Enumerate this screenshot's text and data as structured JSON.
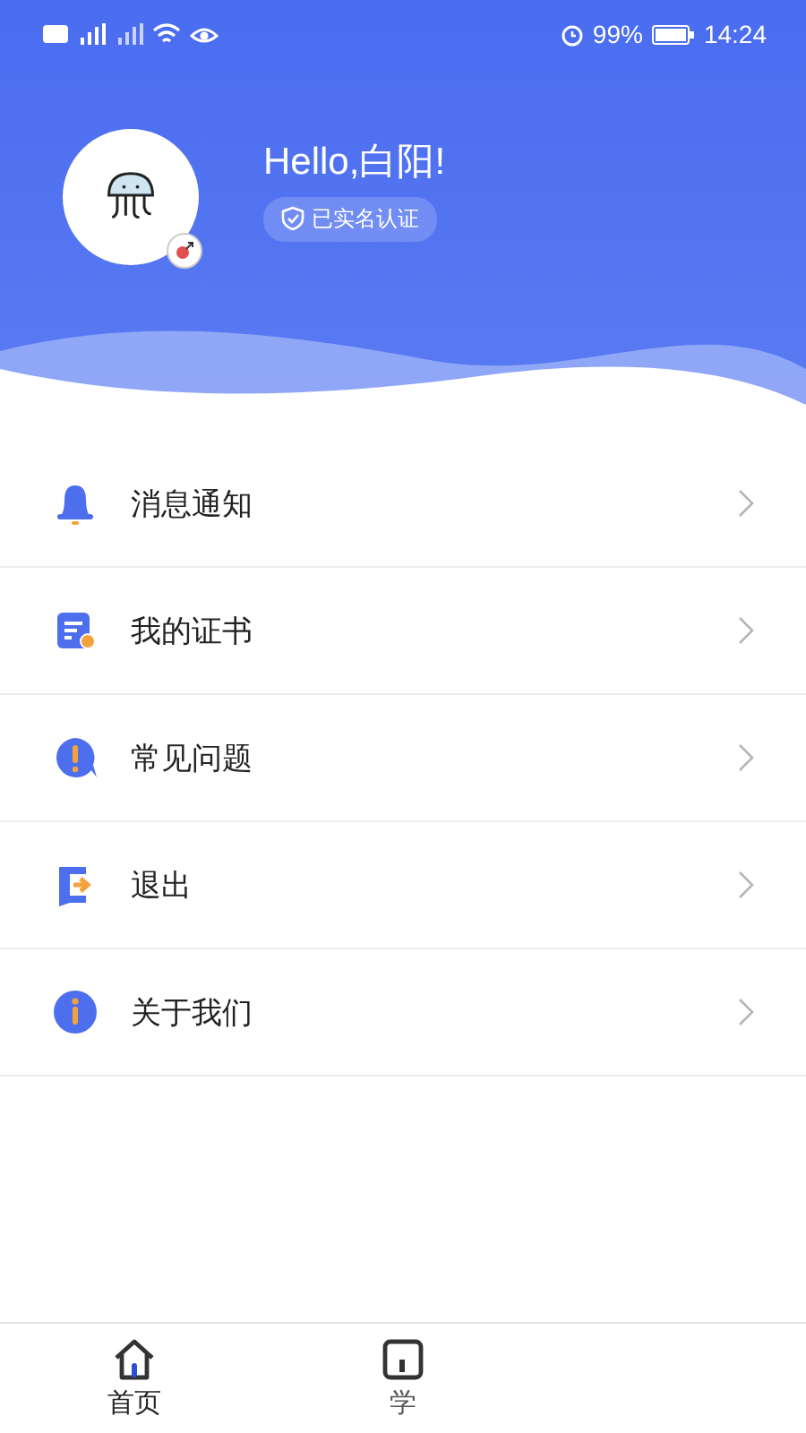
{
  "status_bar": {
    "battery": "99%",
    "time": "14:24"
  },
  "profile": {
    "greeting": "Hello,白阳!",
    "badge": "已实名认证"
  },
  "menu": [
    {
      "kind": "bell",
      "label": "消息通知"
    },
    {
      "kind": "certificate",
      "label": "我的证书"
    },
    {
      "kind": "question",
      "label": "常见问题"
    },
    {
      "kind": "exit",
      "label": "退出"
    },
    {
      "kind": "info",
      "label": "关于我们"
    }
  ],
  "tab_bar": [
    {
      "label": "首页",
      "selected": true
    },
    {
      "label": "学",
      "selected": false
    }
  ]
}
